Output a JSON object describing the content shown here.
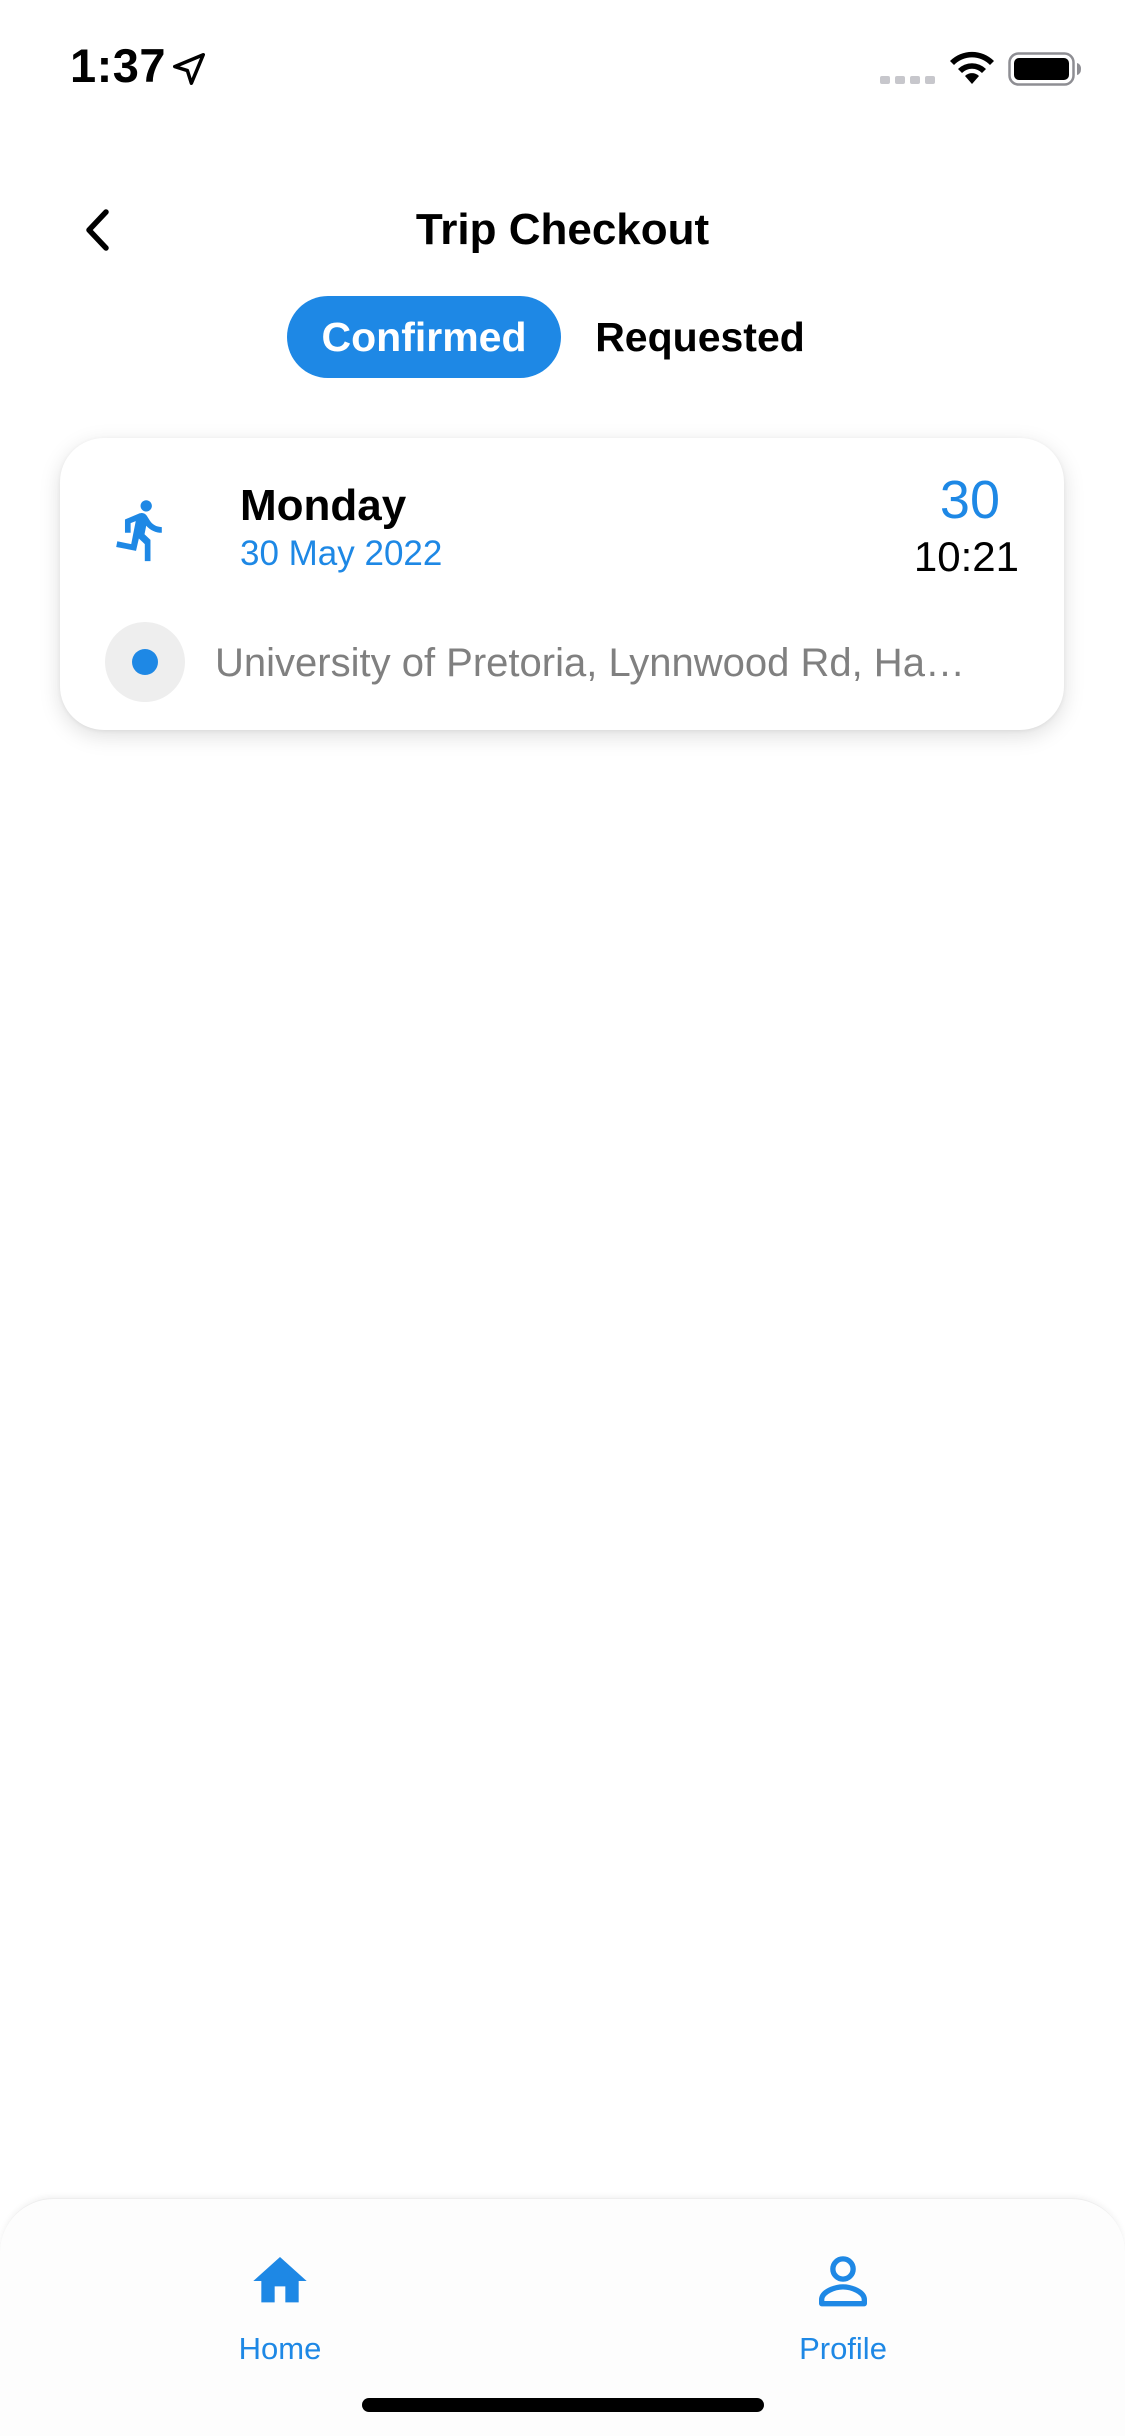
{
  "status_bar": {
    "time": "1:37",
    "icons": [
      "location-arrow-icon",
      "signal-icon",
      "wifi-icon",
      "battery-icon"
    ]
  },
  "header": {
    "title": "Trip Checkout",
    "back_icon": "chevron-left-icon"
  },
  "tabs": [
    {
      "label": "Confirmed",
      "selected": true
    },
    {
      "label": "Requested",
      "selected": false
    }
  ],
  "trips": [
    {
      "mode_icon": "walking-person-icon",
      "day": "Monday",
      "date": "30 May 2022",
      "count": "30",
      "time": "10:21",
      "address": "University of Pretoria, Lynnwood Rd, Ha…"
    }
  ],
  "bottom_nav": [
    {
      "label": "Home",
      "icon": "home-icon"
    },
    {
      "label": "Profile",
      "icon": "person-icon"
    }
  ],
  "colors": {
    "accent": "#1e88e5",
    "text_primary": "#000000",
    "text_secondary": "#808080",
    "background": "#ffffff"
  }
}
